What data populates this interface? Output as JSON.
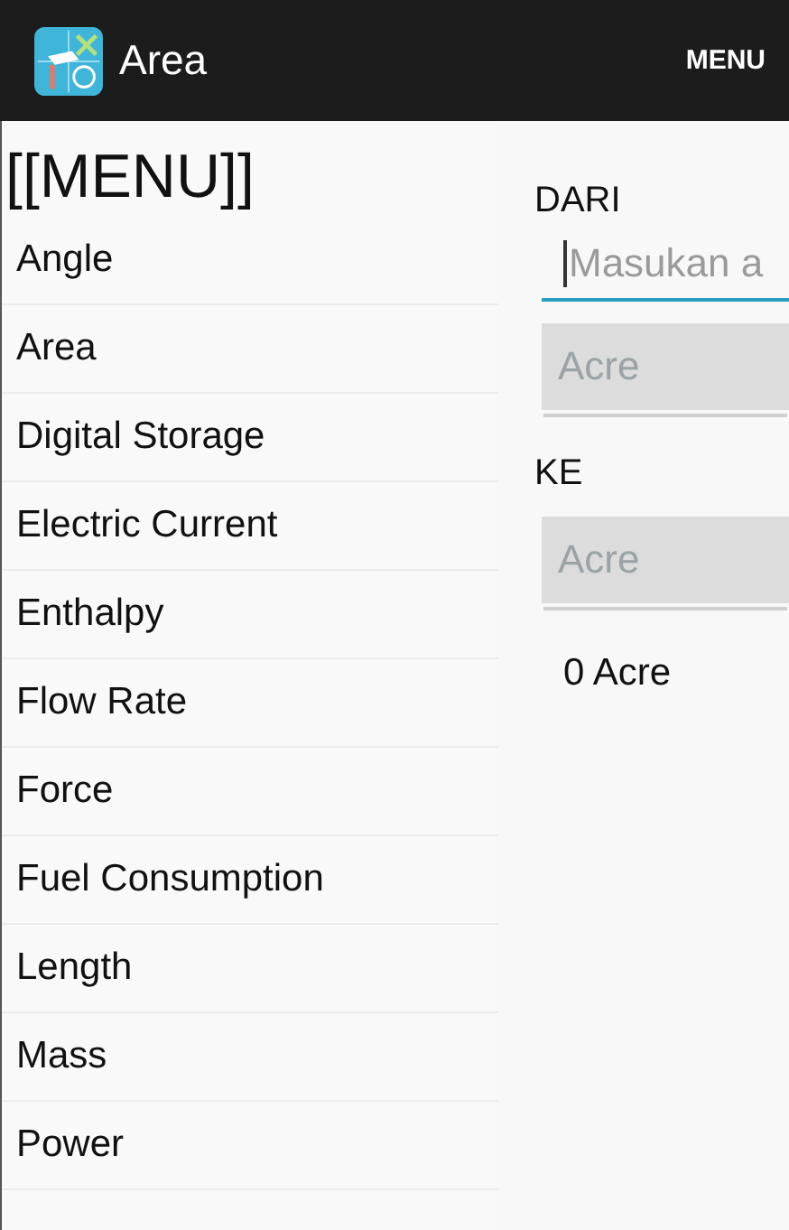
{
  "action_bar": {
    "title": "Area",
    "menu_button": "MENU"
  },
  "menu": {
    "title": "[[MENU]]",
    "items": [
      {
        "label": "Angle"
      },
      {
        "label": "Area"
      },
      {
        "label": "Digital Storage"
      },
      {
        "label": "Electric Current"
      },
      {
        "label": "Enthalpy"
      },
      {
        "label": "Flow Rate"
      },
      {
        "label": "Force"
      },
      {
        "label": "Fuel Consumption"
      },
      {
        "label": "Length"
      },
      {
        "label": "Mass"
      },
      {
        "label": "Power"
      }
    ]
  },
  "converter": {
    "from_label": "DARI",
    "input": {
      "placeholder": "Masukan a"
    },
    "from_unit": "Acre",
    "to_label": "KE",
    "to_unit": "Acre",
    "result": "0 Acre"
  }
}
